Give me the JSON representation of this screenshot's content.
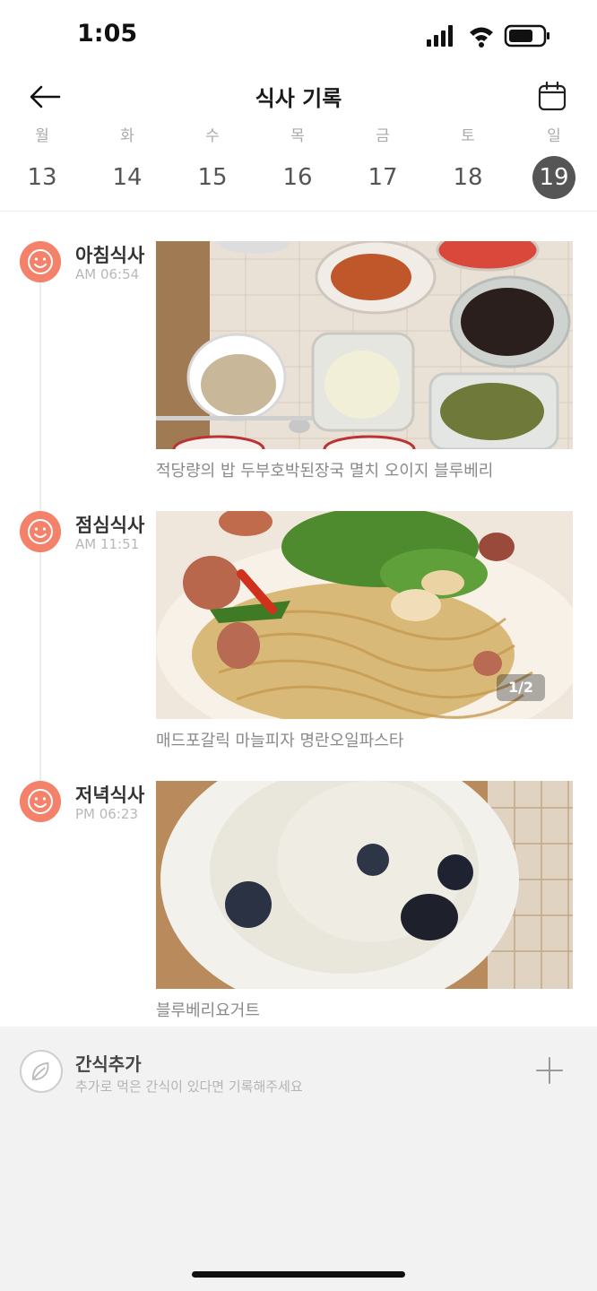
{
  "status_bar": {
    "time": "1:05"
  },
  "header": {
    "title": "식사 기록"
  },
  "week": [
    {
      "dow": "월",
      "date": "13",
      "selected": false
    },
    {
      "dow": "화",
      "date": "14",
      "selected": false
    },
    {
      "dow": "수",
      "date": "15",
      "selected": false
    },
    {
      "dow": "목",
      "date": "16",
      "selected": false
    },
    {
      "dow": "금",
      "date": "17",
      "selected": false
    },
    {
      "dow": "토",
      "date": "18",
      "selected": false
    },
    {
      "dow": "일",
      "date": "19",
      "selected": true
    }
  ],
  "meals": [
    {
      "name": "아침식사",
      "time": "AM 06:54",
      "caption": "적당량의 밥 두부호박된장국 멸치 오이지 블루베리",
      "icon": "smile-icon"
    },
    {
      "name": "점심식사",
      "time": "AM 11:51",
      "caption": "매드포갈릭 마늘피자 명란오일파스타",
      "photo_counter": "1/2",
      "icon": "smile-icon"
    },
    {
      "name": "저녁식사",
      "time": "PM 06:23",
      "caption": "블루베리요거트",
      "icon": "smile-icon"
    }
  ],
  "snack": {
    "title": "간식추가",
    "subtitle": "추가로 먹은 간식이 있다면 기록해주세요",
    "icon": "leaf-icon"
  },
  "colors": {
    "accent": "#f4826b",
    "selected_day": "#555555"
  }
}
